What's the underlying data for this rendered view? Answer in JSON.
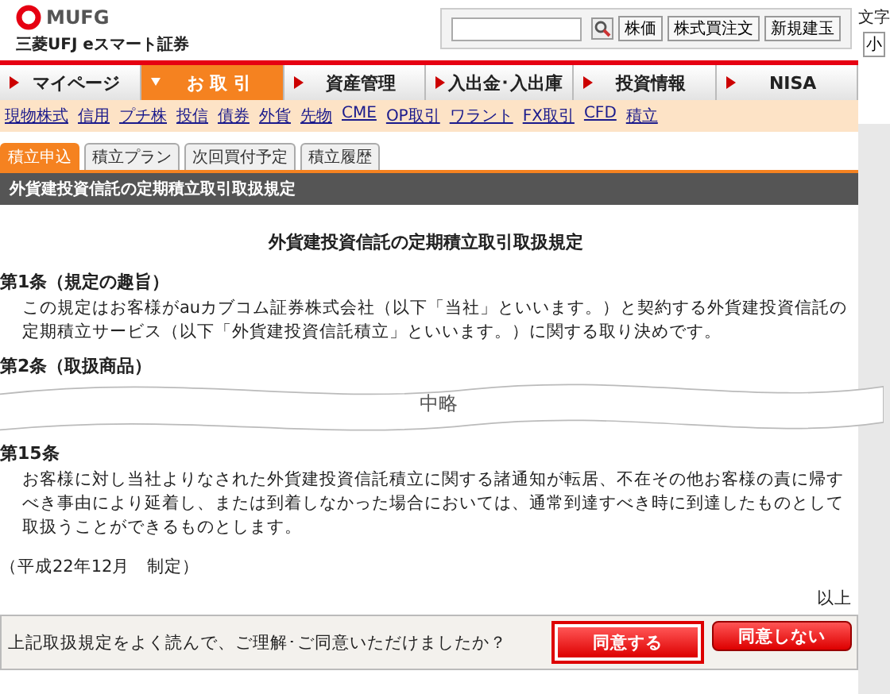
{
  "logo": {
    "brand": "MUFG",
    "company": "三菱UFJ eスマート証券"
  },
  "quick_search": {
    "buttons": [
      "株価",
      "株式買注文",
      "新規建玉"
    ]
  },
  "font_size": {
    "label": "文字",
    "buttons": [
      "小"
    ]
  },
  "main_nav": [
    {
      "label": "マイページ",
      "selected": false
    },
    {
      "label": "お 取 引",
      "selected": true
    },
    {
      "label": "資産管理",
      "selected": false
    },
    {
      "label": "入出金･入出庫",
      "selected": false
    },
    {
      "label": "投資情報",
      "selected": false
    },
    {
      "label": "NISA",
      "selected": false
    }
  ],
  "sub_nav": [
    "現物株式",
    "信用",
    "プチ株",
    "投信",
    "債券",
    "外貨",
    "先物",
    "CME",
    "OP取引",
    "ワラント",
    "FX取引",
    "CFD",
    "積立"
  ],
  "tabs": [
    {
      "label": "積立申込",
      "selected": true
    },
    {
      "label": "積立プラン",
      "selected": false
    },
    {
      "label": "次回買付予定",
      "selected": false
    },
    {
      "label": "積立履歴",
      "selected": false
    }
  ],
  "section_title": "外貨建投資信託の定期積立取引取扱規定",
  "document": {
    "title": "外貨建投資信託の定期積立取引取扱規定",
    "articles": [
      {
        "heading": "第1条（規定の趣旨）",
        "body": "この規定はお客様がauカブコム証券株式会社（以下「当社」といいます。）と契約する外貨建投資信託の定期積立サービス（以下「外貨建投資信託積立」といいます。）に関する取り決めです。"
      },
      {
        "heading": "第2条（取扱商品）"
      }
    ],
    "omission": "中略",
    "articles_after": [
      {
        "heading": "第15条",
        "body": "お客様に対し当社よりなされた外貨建投資信託積立に関する諸通知が転居、不在その他お客様の責に帰すべき事由により延着し、または到着しなかった場合においては、通常到達すべき時に到達したものとして取扱うことができるものとします。"
      }
    ],
    "enactment": "（平成22年12月　制定）",
    "closing": "以上"
  },
  "confirm": {
    "question": "上記取扱規定をよく読んで、ご理解･ご同意いただけましたか？",
    "buttons": [
      {
        "label": "同意する",
        "selected": true
      },
      {
        "label": "同意しない",
        "selected": false
      }
    ]
  }
}
